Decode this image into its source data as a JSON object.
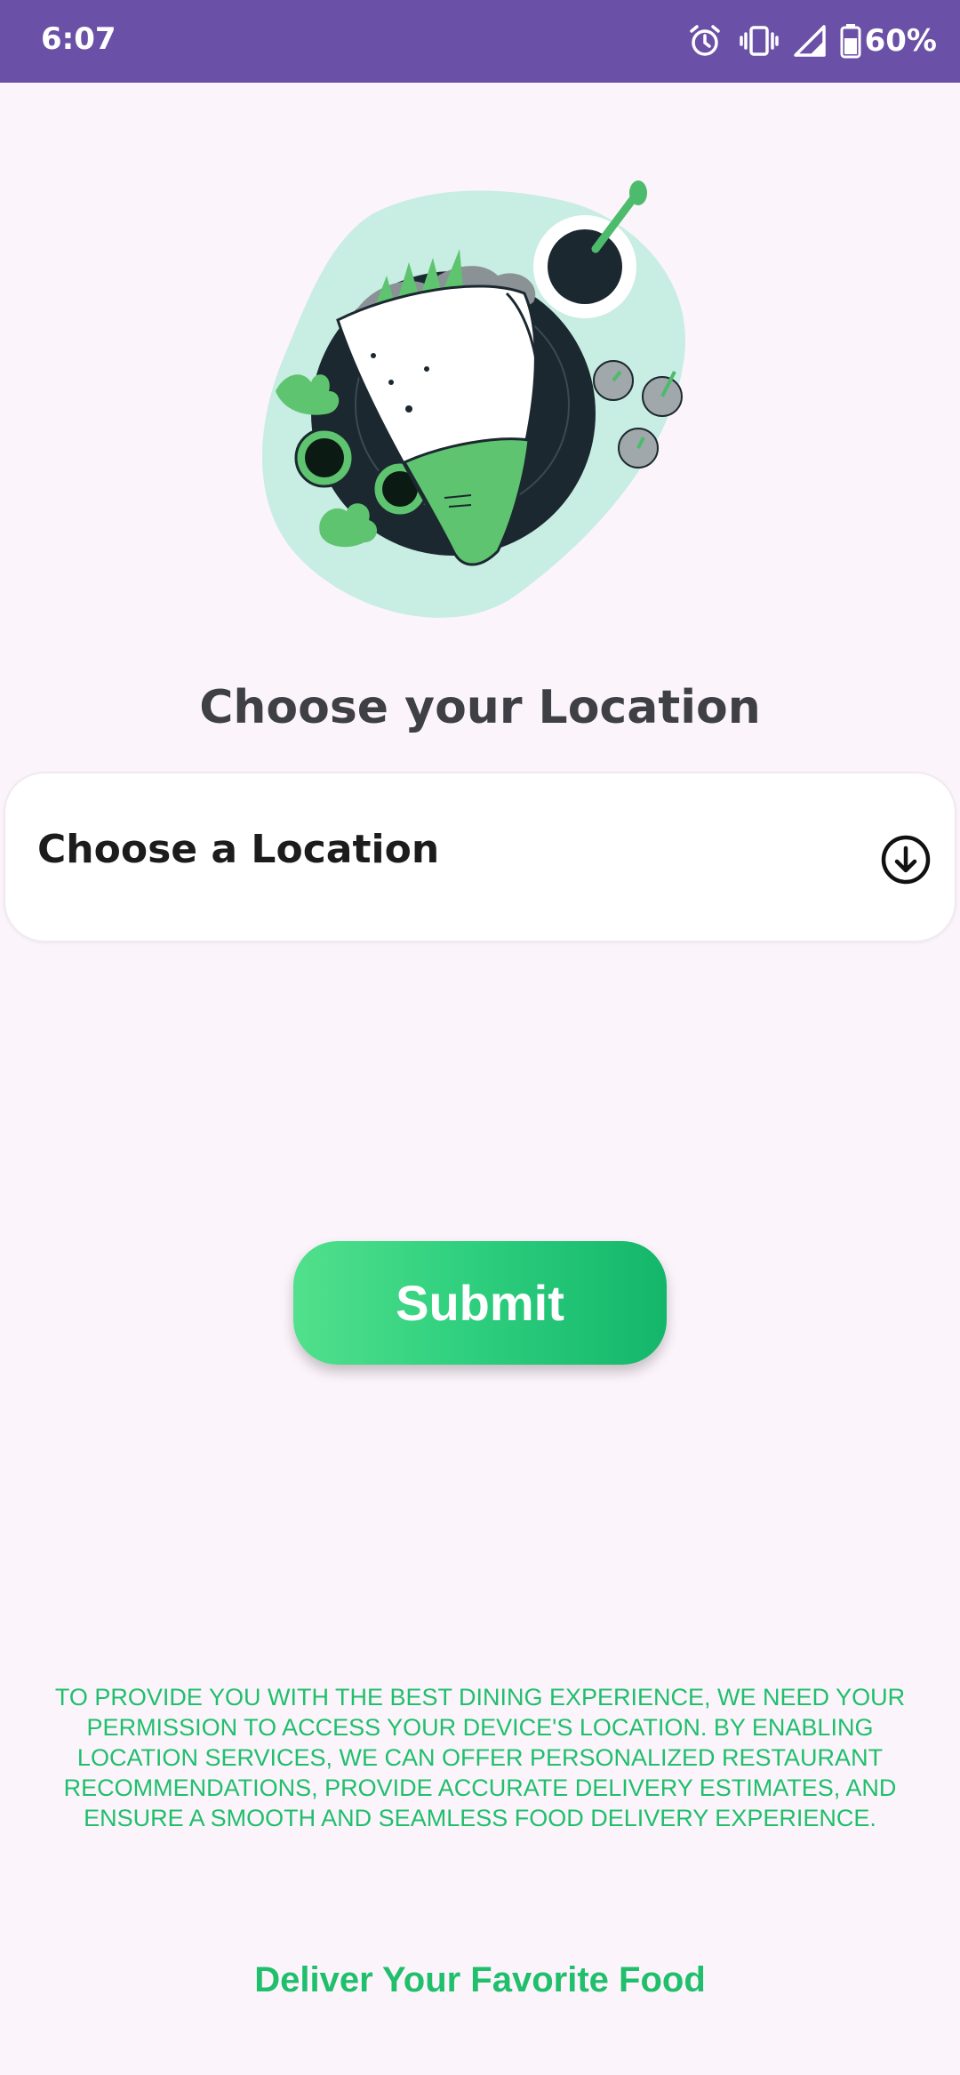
{
  "status_bar": {
    "time": "6:07",
    "battery": "60%",
    "icons": [
      "alarm-icon",
      "vibrate-icon",
      "signal-icon",
      "battery-icon"
    ]
  },
  "hero": {
    "image": "food-wrap-illustration"
  },
  "page": {
    "title": "Choose your Location"
  },
  "location_select": {
    "selected": "Choose a Location",
    "icon": "arrow-down-circle-icon"
  },
  "submit": {
    "label": "Submit"
  },
  "permission_note": "TO PROVIDE YOU WITH THE BEST DINING EXPERIENCE, WE NEED YOUR PERMISSION TO ACCESS YOUR DEVICE'S LOCATION. BY ENABLING LOCATION SERVICES, WE CAN OFFER PERSONALIZED RESTAURANT RECOMMENDATIONS, PROVIDE ACCURATE DELIVERY ESTIMATES, AND ENSURE A SMOOTH AND SEAMLESS FOOD DELIVERY EXPERIENCE.",
  "footer": {
    "tagline": "Deliver Your Favorite Food"
  },
  "colors": {
    "status_bar": "#6a50a6",
    "background": "#fcf4fb",
    "accent_green": "#1fbf6c",
    "title_text": "#3f3f46"
  }
}
